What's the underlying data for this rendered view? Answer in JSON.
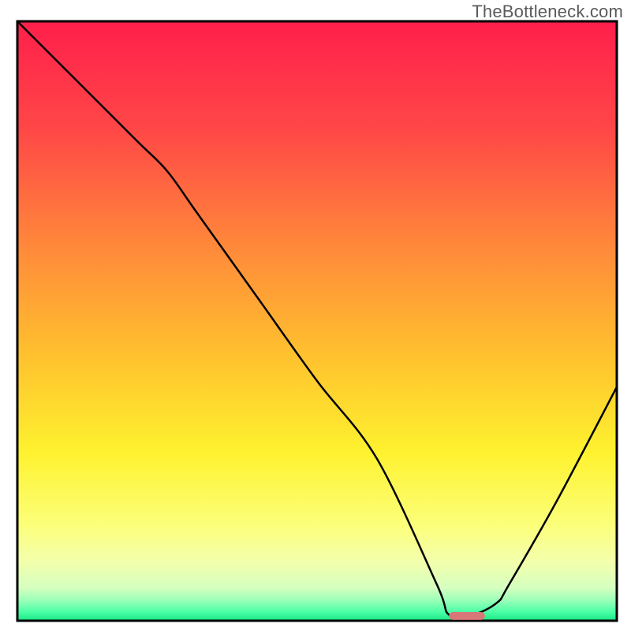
{
  "watermark": "TheBottleneck.com",
  "chart_data": {
    "type": "line",
    "title": "",
    "xlabel": "",
    "ylabel": "",
    "xlim": [
      0,
      100
    ],
    "ylim": [
      0,
      100
    ],
    "series": [
      {
        "name": "bottleneck-curve",
        "x": [
          0,
          10,
          20,
          25,
          30,
          40,
          50,
          60,
          70,
          72,
          76,
          80,
          82,
          90,
          100
        ],
        "y": [
          100,
          90,
          80,
          75,
          68,
          54,
          40,
          27,
          6,
          1,
          1,
          3,
          6,
          20,
          39
        ]
      }
    ],
    "marker": {
      "x": 75,
      "y": 0.8,
      "color": "#d87777",
      "width": 6,
      "height": 1.3
    },
    "gradient_stops": [
      {
        "offset": 0.0,
        "color": "#ff1f4b"
      },
      {
        "offset": 0.18,
        "color": "#ff4747"
      },
      {
        "offset": 0.38,
        "color": "#ff8a3a"
      },
      {
        "offset": 0.56,
        "color": "#ffc22e"
      },
      {
        "offset": 0.72,
        "color": "#fef22f"
      },
      {
        "offset": 0.84,
        "color": "#fcff7a"
      },
      {
        "offset": 0.9,
        "color": "#f4ffab"
      },
      {
        "offset": 0.945,
        "color": "#d6ffc0"
      },
      {
        "offset": 0.965,
        "color": "#9dffb8"
      },
      {
        "offset": 0.985,
        "color": "#4cffa7"
      },
      {
        "offset": 1.0,
        "color": "#18e884"
      }
    ],
    "border_color": "#000000",
    "curve_color": "#000000"
  }
}
